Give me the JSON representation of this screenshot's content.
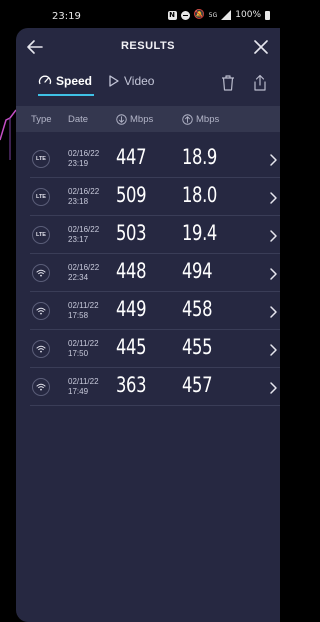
{
  "status_bar": {
    "time": "23:19",
    "battery": "100%",
    "network": "5G"
  },
  "header": {
    "title": "RESULTS"
  },
  "tabs": [
    {
      "label": "Speed",
      "active": true
    },
    {
      "label": "Video",
      "active": false
    }
  ],
  "columns": {
    "type": "Type",
    "date": "Date",
    "download": "Mbps",
    "upload": "Mbps"
  },
  "colors": {
    "panel_bg": "#262841",
    "accent": "#3fc1e6"
  },
  "results": [
    {
      "type": "LTE",
      "date": "02/16/22",
      "time": "23:19",
      "download": "447",
      "upload": "18.9"
    },
    {
      "type": "LTE",
      "date": "02/16/22",
      "time": "23:18",
      "download": "509",
      "upload": "18.0"
    },
    {
      "type": "LTE",
      "date": "02/16/22",
      "time": "23:17",
      "download": "503",
      "upload": "19.4"
    },
    {
      "type": "wifi",
      "date": "02/16/22",
      "time": "22:34",
      "download": "448",
      "upload": "494"
    },
    {
      "type": "wifi",
      "date": "02/11/22",
      "time": "17:58",
      "download": "449",
      "upload": "458"
    },
    {
      "type": "wifi",
      "date": "02/11/22",
      "time": "17:50",
      "download": "445",
      "upload": "455"
    },
    {
      "type": "wifi",
      "date": "02/11/22",
      "time": "17:49",
      "download": "363",
      "upload": "457"
    }
  ]
}
